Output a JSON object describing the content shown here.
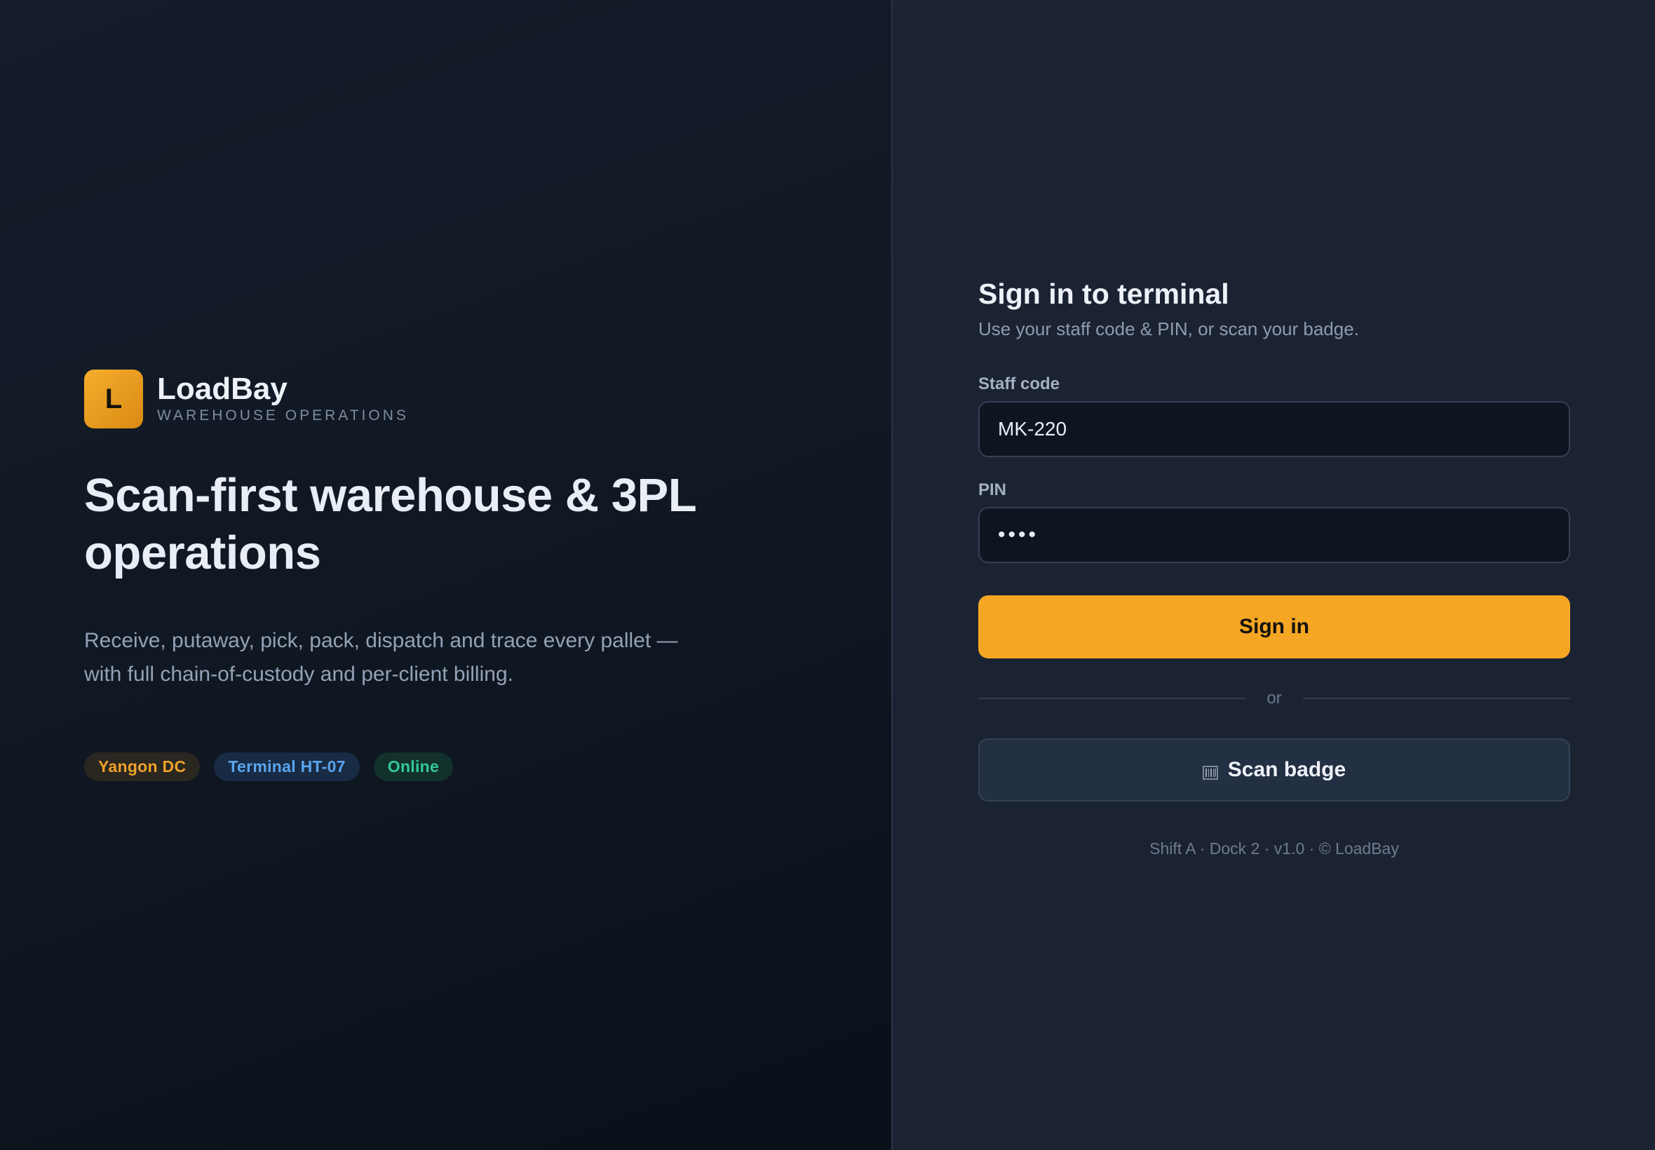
{
  "brand": {
    "logo_letter": "L",
    "name": "LoadBay",
    "tagline": "WAREHOUSE OPERATIONS",
    "accent_color": "#f5a623"
  },
  "hero": {
    "title": "Scan-first warehouse & 3PL operations",
    "description": "Receive, putaway, pick, pack, dispatch and trace every pallet — with full chain-of-custody and per-client billing."
  },
  "chips": [
    {
      "label": "Yangon DC",
      "color": "#eea22a"
    },
    {
      "label": "Terminal HT-07",
      "color": "#5aa4ee"
    },
    {
      "label": "Online",
      "color": "#34c99a"
    }
  ],
  "signin": {
    "title": "Sign in to terminal",
    "subtitle": "Use your staff code & PIN, or scan your badge.",
    "staff_code_label": "Staff code",
    "staff_code_value": "MK-220",
    "pin_label": "PIN",
    "pin_value": "••••",
    "signin_button": "Sign in",
    "divider_text": "or",
    "scan_button": "Scan badge",
    "scan_icon": "barcode-icon"
  },
  "footer": {
    "text": "Shift A · Dock 2 · v1.0 · © LoadBay"
  }
}
